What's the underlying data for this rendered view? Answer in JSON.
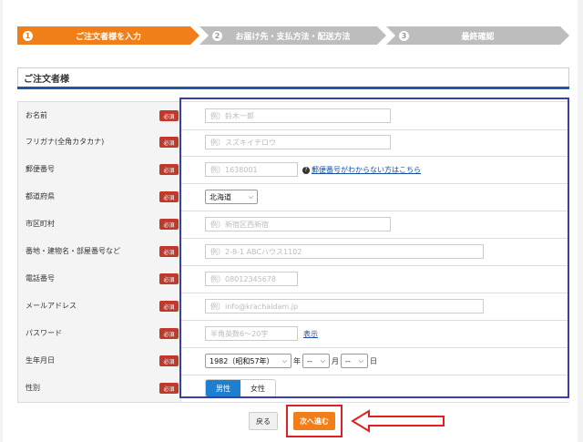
{
  "steps": [
    {
      "num": "1",
      "label": "ご注文者様を入力"
    },
    {
      "num": "2",
      "label": "お届け先・支払方法・配送方法"
    },
    {
      "num": "3",
      "label": "最終確認"
    }
  ],
  "section_title": "ご注文者様",
  "required_label": "必須",
  "fields": {
    "name": {
      "label": "お名前",
      "placeholder": "例）鈴木一郎"
    },
    "kana": {
      "label": "フリガナ(全角カタカナ)",
      "placeholder": "例）スズキイチロウ"
    },
    "postal": {
      "label": "郵便番号",
      "placeholder": "例）1638001",
      "help_icon": "?",
      "help_link": "郵便番号がわからない方はこちら"
    },
    "prefecture": {
      "label": "都道府県",
      "value": "北海道"
    },
    "city": {
      "label": "市区町村",
      "placeholder": "例）新宿区西新宿"
    },
    "address": {
      "label": "番地・建物名・部屋番号など",
      "placeholder": "例）2-8-1 ABCハウス1102"
    },
    "phone": {
      "label": "電話番号",
      "placeholder": "例）08012345678"
    },
    "email": {
      "label": "メールアドレス",
      "placeholder": "例）info@krachaidam.jp"
    },
    "password": {
      "label": "パスワード",
      "placeholder": "半角英数6～20字",
      "show_link": "表示"
    },
    "birthday": {
      "label": "生年月日",
      "year": "1982（昭和57年）",
      "year_unit": "年",
      "month": "--",
      "month_unit": "月",
      "day": "--",
      "day_unit": "日"
    },
    "gender": {
      "label": "性別",
      "male": "男性",
      "female": "女性"
    }
  },
  "buttons": {
    "back": "戻る",
    "next": "次へ進む"
  },
  "colors": {
    "accent": "#f07f19",
    "required": "#c0392b",
    "heading_line": "#1f57a8",
    "selected": "#1e7fd0",
    "highlight_box": "#3d3daa",
    "highlight_red": "#e02020"
  }
}
